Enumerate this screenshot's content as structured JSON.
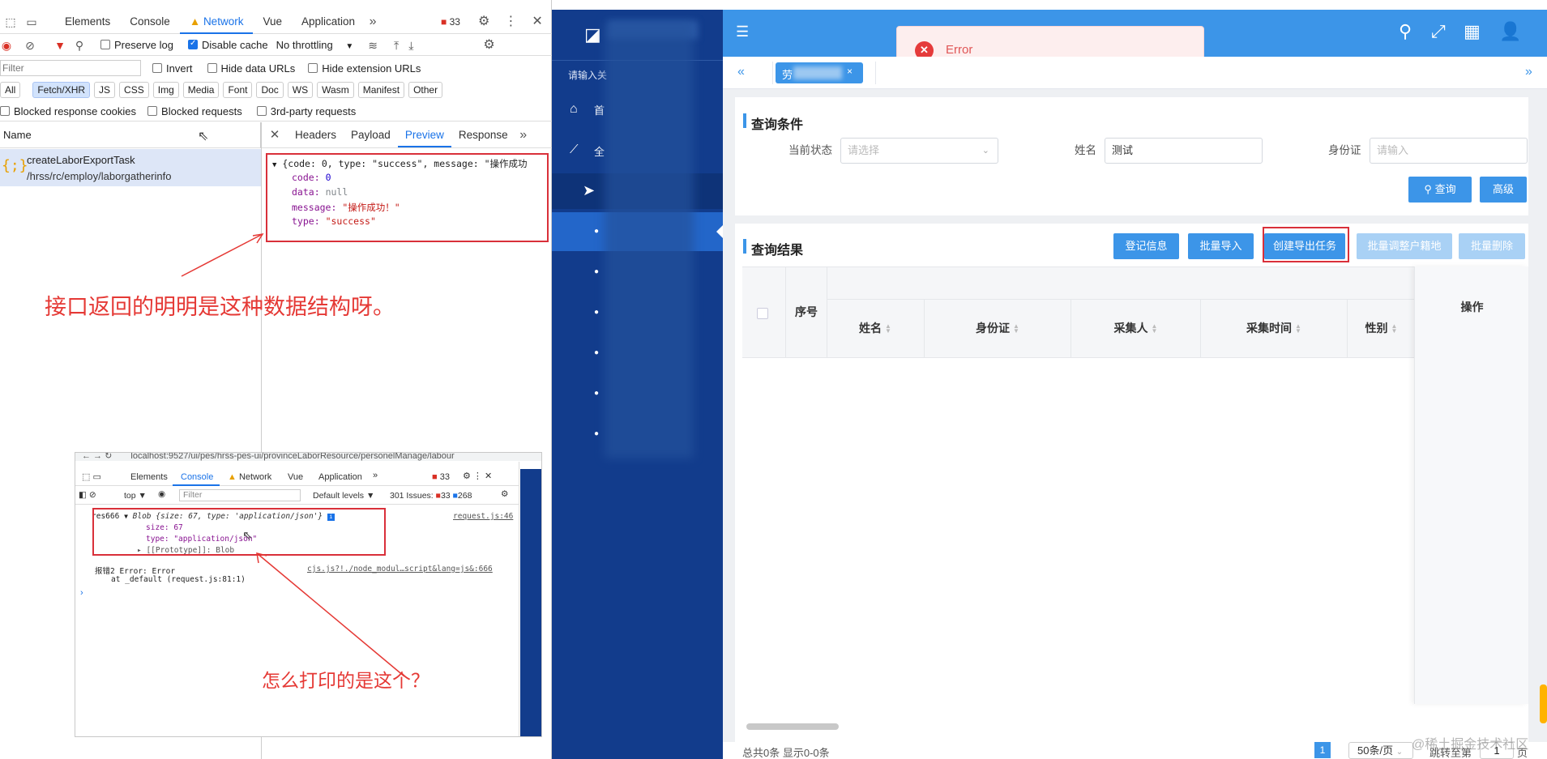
{
  "devtools": {
    "tabs": [
      "Elements",
      "Console",
      "Network",
      "Vue",
      "Application"
    ],
    "active_tab": "Network",
    "issue_count": "33",
    "toolbar": {
      "preserve_log": "Preserve log",
      "disable_cache": "Disable cache",
      "throttling": "No throttling"
    },
    "filter": {
      "placeholder": "Filter",
      "invert": "Invert",
      "hide_data_urls": "Hide data URLs",
      "hide_extension_urls": "Hide extension URLs"
    },
    "type_filters": [
      "All",
      "Fetch/XHR",
      "JS",
      "CSS",
      "Img",
      "Media",
      "Font",
      "Doc",
      "WS",
      "Wasm",
      "Manifest",
      "Other"
    ],
    "active_type": "Fetch/XHR",
    "blocked_cookies": "Blocked response cookies",
    "blocked_requests": "Blocked requests",
    "third_party": "3rd-party requests",
    "name_header": "Name",
    "request": {
      "name": "createLaborExportTask",
      "path": "/hrss/rc/employ/laborgatherinfo"
    },
    "detail_tabs": [
      "Headers",
      "Payload",
      "Preview",
      "Response"
    ],
    "active_detail_tab": "Preview",
    "preview": {
      "summary": "{code: 0, type: \"success\", message: \"操作成功",
      "code_key": "code:",
      "code_val": "0",
      "data_key": "data:",
      "data_val": "null",
      "message_key": "message:",
      "message_val": "\"操作成功！\"",
      "type_key": "type:",
      "type_val": "\"success\""
    }
  },
  "annotations": {
    "top": "接口返回的明明是这种数据结构呀。",
    "bottom": "怎么打印的是这个？"
  },
  "inset": {
    "url": "localhost:9527/ui/pes/hrss-pes-ui/provinceLaborResource/personelManage/labour",
    "tabs": [
      "Elements",
      "Console",
      "Network",
      "Vue",
      "Application"
    ],
    "active_tab": "Console",
    "issue_count": "33",
    "context": "top",
    "filter_placeholder": "Filter",
    "levels": "Default levels",
    "issues_label": "301 Issues:",
    "issues_err": "33",
    "issues_info": "268",
    "log1_prefix": "res666",
    "log1_summary": "Blob {size: 67, type: 'application/json'}",
    "log1_size": "size: 67",
    "log1_type": "type: \"application/json\"",
    "log1_proto": "[[Prototype]]: Blob",
    "log1_source": "request.js:46",
    "log2_text": "报错2 Error: Error",
    "log2_at": "at _default (request.js:81:1)",
    "log2_source": "cjs.js?!./node_modul…script&lang=js&:666"
  },
  "app": {
    "nav_search_placeholder": "请输入关",
    "nav_home": "首",
    "nav_all": "全",
    "error_toast": "Error",
    "tag_label": "劳",
    "query_title": "查询条件",
    "status_label": "当前状态",
    "status_placeholder": "请选择",
    "name_label": "姓名",
    "name_value": "测试",
    "id_label": "身份证",
    "id_placeholder": "请输入",
    "search_btn": "查询",
    "advanced_btn": "高级",
    "result_title": "查询结果",
    "actions": [
      "登记信息",
      "批量导入",
      "创建导出任务",
      "批量调整户籍地",
      "批量删除"
    ],
    "columns": {
      "seq": "序号",
      "name": "姓名",
      "id": "身份证",
      "collector": "采集人",
      "collect_time": "采集时间",
      "gender": "性别",
      "ops": "操作"
    },
    "footer": {
      "total": "总共0条 显示0-0条",
      "page": "1",
      "page_size": "50条/页",
      "jump": "跳转至第",
      "jump_page": "1",
      "page_unit": "页"
    },
    "watermark": "@稀土掘金技术社区"
  }
}
